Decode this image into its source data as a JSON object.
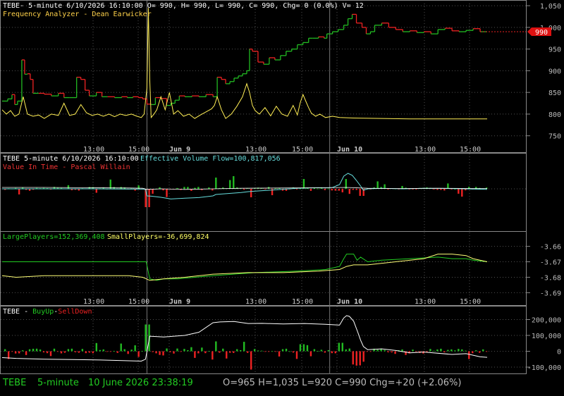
{
  "colors": {
    "bg": "#000000",
    "up": "#22bb22",
    "down": "#ee2222",
    "yellow": "#ffff66",
    "white": "#ffffff",
    "cyan": "#66dddd",
    "green": "#22cc22",
    "grid": "#505050",
    "axis": "#888888",
    "label": "#cccccc",
    "tick": "#bbbbbb"
  },
  "panel1": {
    "header": "TEBE- 5-minute 6/10/2026 16:10:00 O= 990, H= 990, L= 990, C= 990, Chg= 0 (0.0%) V= 12",
    "indicator": "Frequency Analyzer - Dean Earwicker",
    "last_price_label": "990"
  },
  "panel2": {
    "header": "TEBE 5-minute  6/10/2026 16:10:00",
    "indicator1": "Effective Volume Flow=100,817,056",
    "indicator2": "Value In Time - Pascal Willain"
  },
  "panel3": {
    "large_label": "LargePlayers=152,369,408",
    "small_label": "SmallPlayers=-36,699,824"
  },
  "panel4": {
    "symbol": "TEBE - ",
    "buy": "BuyUp",
    "sep": "-",
    "sell": "SellDown"
  },
  "status": {
    "symbol": "TEBE",
    "interval": "5-minute",
    "datetime": "10 June 2026 23:38:19",
    "ohlc": "O=965  H=1,035  L=920  C=990  Chg=+20 (+2.06%)"
  },
  "time_axis": {
    "labels": [
      "13:00",
      "15:00",
      "Jun 9",
      "13:00",
      "15:00",
      "Jun 10",
      "13:00",
      "15:00"
    ],
    "bold": [
      false,
      false,
      true,
      false,
      false,
      true,
      false,
      false
    ]
  },
  "chart_data": [
    {
      "type": "candlestick",
      "title": "TEBE- 5-minute",
      "ylim": [
        730,
        1055
      ],
      "yticks": [
        750,
        800,
        850,
        900,
        950,
        1000,
        1050
      ],
      "ytick_labels": [
        "750",
        "800",
        "850",
        "900",
        "950",
        "1,000",
        "1,050"
      ],
      "last": 990,
      "close_path": [
        [
          0,
          830
        ],
        [
          8,
          835
        ],
        [
          14,
          845
        ],
        [
          18,
          822
        ],
        [
          22,
          830
        ],
        [
          28,
          925
        ],
        [
          32,
          892
        ],
        [
          36,
          893
        ],
        [
          40,
          880
        ],
        [
          44,
          848
        ],
        [
          52,
          848
        ],
        [
          60,
          846
        ],
        [
          70,
          842
        ],
        [
          80,
          848
        ],
        [
          88,
          838
        ],
        [
          96,
          838
        ],
        [
          106,
          885
        ],
        [
          112,
          880
        ],
        [
          118,
          855
        ],
        [
          124,
          842
        ],
        [
          134,
          850
        ],
        [
          142,
          840
        ],
        [
          150,
          840
        ],
        [
          160,
          838
        ],
        [
          170,
          840
        ],
        [
          178,
          838
        ],
        [
          186,
          840
        ],
        [
          194,
          838
        ],
        [
          200,
          835
        ],
        [
          206,
          823
        ],
        [
          212,
          822
        ],
        [
          218,
          838
        ],
        [
          226,
          836
        ],
        [
          234,
          820
        ],
        [
          240,
          825
        ],
        [
          246,
          832
        ],
        [
          252,
          842
        ],
        [
          260,
          840
        ],
        [
          270,
          842
        ],
        [
          280,
          840
        ],
        [
          290,
          845
        ],
        [
          300,
          840
        ],
        [
          306,
          885
        ],
        [
          312,
          880
        ],
        [
          318,
          870
        ],
        [
          324,
          875
        ],
        [
          330,
          883
        ],
        [
          336,
          888
        ],
        [
          342,
          893
        ],
        [
          348,
          900
        ],
        [
          352,
          950
        ],
        [
          356,
          945
        ],
        [
          364,
          920
        ],
        [
          372,
          915
        ],
        [
          380,
          930
        ],
        [
          388,
          925
        ],
        [
          396,
          935
        ],
        [
          404,
          945
        ],
        [
          412,
          950
        ],
        [
          420,
          960
        ],
        [
          428,
          965
        ],
        [
          436,
          975
        ],
        [
          442,
          975
        ],
        [
          450,
          978
        ],
        [
          458,
          975
        ],
        [
          462,
          985
        ],
        [
          470,
          990
        ],
        [
          478,
          995
        ],
        [
          486,
          1005
        ],
        [
          492,
          1020
        ],
        [
          498,
          1030
        ],
        [
          504,
          1010
        ],
        [
          512,
          1000
        ],
        [
          518,
          985
        ],
        [
          524,
          990
        ],
        [
          530,
          1005
        ],
        [
          540,
          1010
        ],
        [
          550,
          1000
        ],
        [
          560,
          995
        ],
        [
          570,
          990
        ],
        [
          580,
          992
        ],
        [
          590,
          988
        ],
        [
          600,
          990
        ],
        [
          610,
          985
        ],
        [
          620,
          995
        ],
        [
          630,
          998
        ],
        [
          640,
          992
        ],
        [
          650,
          990
        ],
        [
          660,
          993
        ],
        [
          670,
          997
        ],
        [
          680,
          990
        ],
        [
          690,
          990
        ]
      ]
    },
    {
      "type": "line",
      "name": "Frequency Analyzer - Dean Earwicker",
      "x": [
        0,
        6,
        12,
        18,
        24,
        30,
        36,
        44,
        52,
        60,
        70,
        80,
        88,
        96,
        104,
        112,
        120,
        128,
        136,
        144,
        152,
        160,
        168,
        176,
        184,
        192,
        198,
        202,
        206,
        208,
        210,
        212,
        216,
        220,
        226,
        232,
        238,
        244,
        250,
        258,
        266,
        274,
        282,
        290,
        298,
        302,
        306,
        312,
        318,
        326,
        334,
        342,
        348,
        352,
        356,
        360,
        366,
        374,
        382,
        390,
        398,
        406,
        414,
        420,
        424,
        428,
        432,
        436,
        440,
        446,
        452,
        460,
        470,
        480,
        500,
        540,
        580,
        620,
        660,
        690
      ],
      "y": [
        810,
        800,
        808,
        795,
        800,
        840,
        800,
        795,
        798,
        790,
        800,
        797,
        825,
        797,
        800,
        822,
        803,
        797,
        800,
        795,
        800,
        794,
        800,
        797,
        800,
        795,
        792,
        800,
        860,
        1045,
        880,
        792,
        800,
        810,
        840,
        810,
        850,
        800,
        808,
        795,
        800,
        790,
        798,
        805,
        812,
        820,
        840,
        810,
        790,
        800,
        818,
        840,
        870,
        850,
        820,
        808,
        800,
        815,
        796,
        818,
        800,
        795,
        820,
        798,
        826,
        845,
        830,
        815,
        802,
        795,
        800,
        792,
        795,
        792,
        791,
        790,
        789,
        789,
        789,
        789
      ]
    },
    {
      "type": "line",
      "name": "Effective Volume Flow",
      "x": [
        0,
        60,
        120,
        180,
        200,
        204,
        206,
        212,
        226,
        240,
        260,
        280,
        300,
        304,
        320,
        340,
        350,
        360,
        380,
        420,
        450,
        460,
        470,
        480,
        486,
        492,
        498,
        504,
        510,
        514,
        520,
        540,
        570,
        600,
        640,
        690
      ],
      "y": [
        0,
        0,
        0,
        -0.01,
        -0.01,
        -0.02,
        -0.25,
        -0.26,
        -0.3,
        -0.36,
        -0.33,
        -0.31,
        -0.25,
        -0.2,
        -0.17,
        -0.13,
        -0.1,
        -0.08,
        -0.05,
        0.02,
        0.04,
        0.03,
        0.05,
        0.15,
        0.45,
        0.55,
        0.48,
        0.3,
        0.1,
        -0.05,
        0.0,
        0.02,
        0.0,
        0.02,
        0.01,
        -0.02
      ]
    },
    {
      "type": "line",
      "name": "Value In Time - Pascal Willain",
      "x": [
        0,
        60,
        120,
        180,
        200,
        206,
        226,
        260,
        300,
        340,
        400,
        460,
        490,
        520,
        560,
        620,
        690
      ],
      "y": [
        0.05,
        0.05,
        0.04,
        0.03,
        0.02,
        -0.02,
        0,
        -0.02,
        0,
        0.02,
        0.03,
        0.04,
        0.05,
        0.02,
        0.01,
        0.02,
        0.01
      ]
    },
    {
      "type": "line",
      "name": "LargePlayers",
      "ylim": [
        -3.695,
        -3.65
      ],
      "yticks": [
        -3.66,
        -3.67,
        -3.68,
        -3.69
      ],
      "ytick_labels": [
        "-3.66",
        "-3.67",
        "-3.68",
        "-3.69"
      ],
      "x": [
        0,
        40,
        100,
        150,
        200,
        205,
        210,
        220,
        230,
        250,
        300,
        360,
        420,
        460,
        480,
        486,
        490,
        500,
        505,
        510,
        520,
        540,
        580,
        620,
        640,
        660,
        670,
        690
      ],
      "y": [
        -3.67,
        -3.67,
        -3.67,
        -3.67,
        -3.67,
        -3.67,
        -3.681,
        -3.682,
        -3.681,
        -3.681,
        -3.679,
        -3.677,
        -3.676,
        -3.675,
        -3.673,
        -3.668,
        -3.665,
        -3.665,
        -3.669,
        -3.667,
        -3.67,
        -3.669,
        -3.668,
        -3.667,
        -3.668,
        -3.668,
        -3.669,
        -3.67
      ]
    },
    {
      "type": "line",
      "name": "SmallPlayers",
      "x": [
        0,
        20,
        60,
        120,
        180,
        200,
        210,
        230,
        260,
        300,
        350,
        400,
        450,
        480,
        490,
        500,
        520,
        560,
        600,
        620,
        640,
        660,
        670,
        690
      ],
      "y": [
        -3.679,
        -3.68,
        -3.679,
        -3.679,
        -3.679,
        -3.68,
        -3.682,
        -3.681,
        -3.68,
        -3.678,
        -3.677,
        -3.677,
        -3.676,
        -3.675,
        -3.673,
        -3.672,
        -3.672,
        -3.67,
        -3.668,
        -3.665,
        -3.665,
        -3.666,
        -3.668,
        -3.67
      ]
    },
    {
      "type": "bar",
      "name": "BuyUp-SellDown",
      "ylim": [
        -140000,
        260000
      ],
      "yticks": [
        200000,
        100000,
        0,
        -100000
      ],
      "ytick_labels": [
        "200,000",
        "100,000",
        "0",
        "-100,000"
      ],
      "line_name": "BuyUp-SellDown cumulative",
      "line_x": [
        0,
        20,
        60,
        100,
        140,
        180,
        198,
        204,
        210,
        230,
        260,
        280,
        300,
        310,
        330,
        350,
        370,
        400,
        430,
        460,
        480,
        486,
        490,
        494,
        500,
        506,
        510,
        514,
        520,
        540,
        560,
        580,
        600,
        640,
        660,
        680,
        690
      ],
      "line_y": [
        -40000,
        -45000,
        -50000,
        -52000,
        -55000,
        -60000,
        -62000,
        -50000,
        95000,
        90000,
        100000,
        120000,
        180000,
        185000,
        188000,
        175000,
        176000,
        172000,
        175000,
        170000,
        165000,
        210000,
        225000,
        220000,
        190000,
        120000,
        70000,
        30000,
        10000,
        15000,
        5000,
        -10000,
        -5000,
        -20000,
        -15000,
        -35000,
        -38000
      ]
    }
  ]
}
